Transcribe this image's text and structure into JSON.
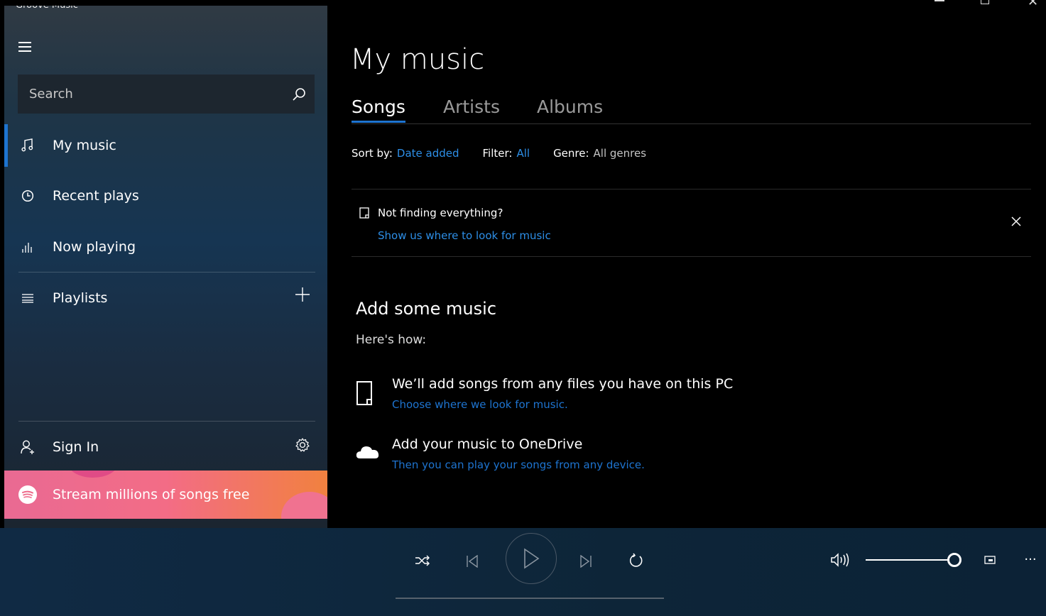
{
  "app": {
    "title": "Groove Music"
  },
  "sidebar": {
    "search_placeholder": "Search",
    "items": [
      {
        "id": "my-music",
        "label": "My music",
        "icon": "music-note-icon",
        "active": true
      },
      {
        "id": "recent-plays",
        "label": "Recent plays",
        "icon": "clock-icon"
      },
      {
        "id": "now-playing",
        "label": "Now playing",
        "icon": "equalizer-icon"
      },
      {
        "id": "playlists",
        "label": "Playlists",
        "icon": "playlist-icon"
      }
    ],
    "sign_in": "Sign In",
    "promo": "Stream millions of songs free"
  },
  "main": {
    "title": "My music",
    "tabs": [
      {
        "label": "Songs",
        "active": true
      },
      {
        "label": "Artists"
      },
      {
        "label": "Albums"
      }
    ],
    "sort": {
      "label": "Sort by:",
      "value": "Date added"
    },
    "filter": {
      "label": "Filter:",
      "value": "All"
    },
    "genre": {
      "label": "Genre:",
      "value": "All genres"
    },
    "banner": {
      "title": "Not finding everything?",
      "link": "Show us where to look for music"
    },
    "add_section": {
      "title": "Add some music",
      "subtitle": "Here's how:",
      "items": [
        {
          "title": "We’ll add songs from any files you have on this PC",
          "link": "Choose where we look for music.",
          "icon": "file-icon"
        },
        {
          "title": "Add your music to OneDrive",
          "link": "Then you can play your songs from any device.",
          "icon": "cloud-icon"
        }
      ]
    }
  },
  "player": {
    "volume_level": 1.0,
    "controls": [
      "shuffle-icon",
      "previous-icon",
      "play-icon",
      "next-icon",
      "repeat-icon",
      "volume-icon",
      "mini-player-icon",
      "more-icon"
    ]
  },
  "colors": {
    "accent": "#1e74d0",
    "link": "#2d8ee6",
    "promo_start": "#e96a93",
    "promo_end": "#f1813f"
  }
}
